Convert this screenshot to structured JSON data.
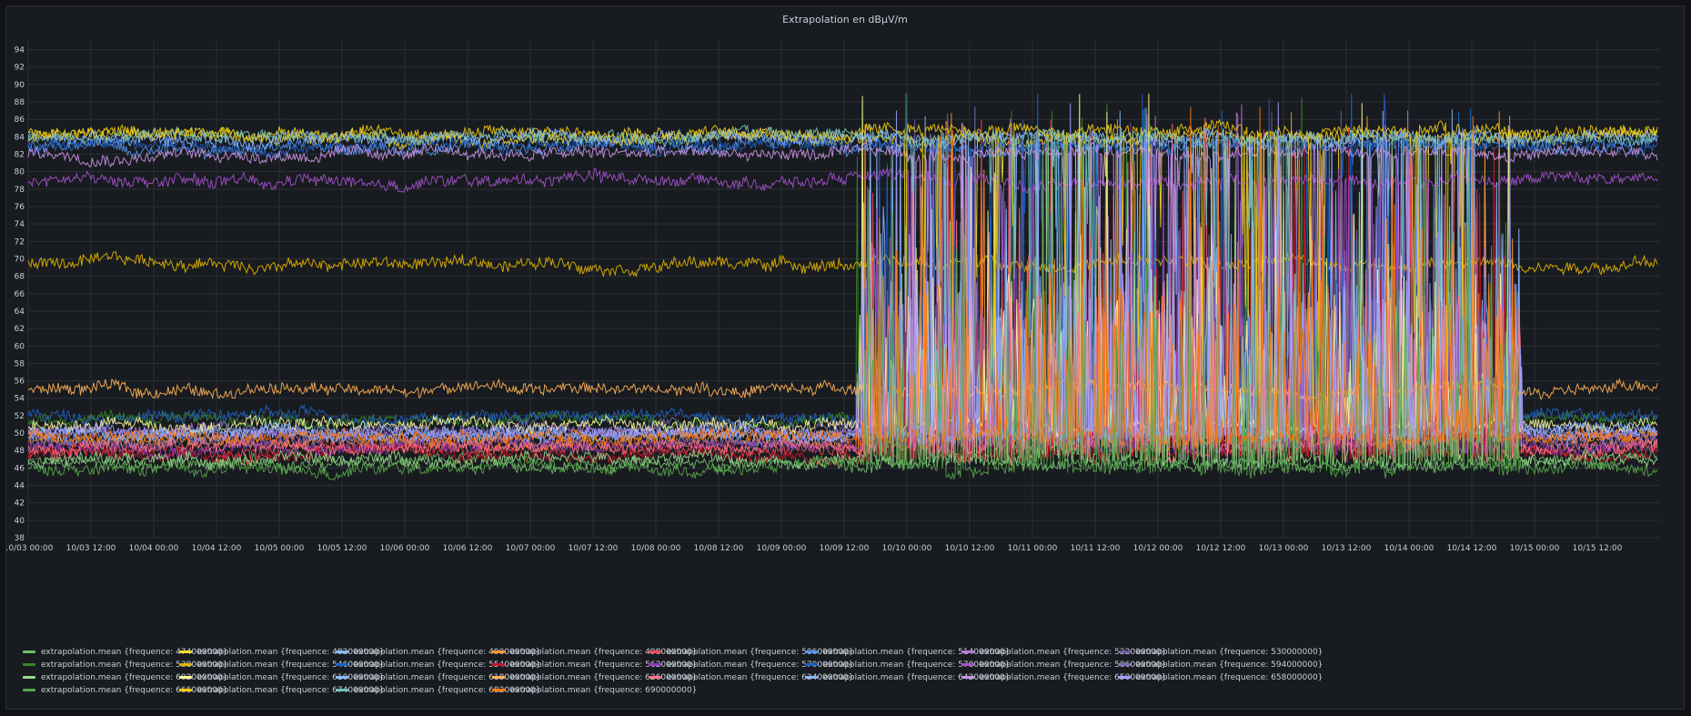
{
  "panel": {
    "title": "Extrapolation en dBµV/m"
  },
  "chart_data": {
    "type": "line",
    "title": "Extrapolation en dBµV/m",
    "xlabel": "",
    "ylabel": "",
    "ylim": [
      38,
      95
    ],
    "xlim": [
      "2023-10-03 00:00",
      "2023-10-15 23:00"
    ],
    "yticks": [
      38,
      40,
      42,
      44,
      46,
      48,
      50,
      52,
      54,
      56,
      58,
      60,
      62,
      64,
      66,
      68,
      70,
      72,
      74,
      76,
      78,
      80,
      82,
      84,
      86,
      88,
      90,
      92,
      94
    ],
    "xticks": [
      "10/03 00:00",
      "10/03 12:00",
      "10/04 00:00",
      "10/04 12:00",
      "10/05 00:00",
      "10/05 12:00",
      "10/06 00:00",
      "10/06 12:00",
      "10/07 00:00",
      "10/07 12:00",
      "10/08 00:00",
      "10/08 12:00",
      "10/09 00:00",
      "10/09 12:00",
      "10/10 00:00",
      "10/10 12:00",
      "10/11 00:00",
      "10/11 12:00",
      "10/12 00:00",
      "10/12 12:00",
      "10/13 00:00",
      "10/13 12:00",
      "10/14 00:00",
      "10/14 12:00",
      "10/15 00:00",
      "10/15 12:00"
    ],
    "grid": true,
    "legend_position": "bottom",
    "x_timestamps_hours": "hourly samples from 10/03 00:00",
    "series": [
      {
        "name": "extrapolation.mean {frequence: 474000000}",
        "color": "#73bf69",
        "baseline": 46.5,
        "active": []
      },
      {
        "name": "extrapolation.mean {frequence: 482000000}",
        "color": "#fade2a",
        "baseline": 84,
        "active": []
      },
      {
        "name": "extrapolation.mean {frequence: 490000000}",
        "color": "#8ab8ff",
        "baseline": 50,
        "active": [
          [
            6.6,
            11.9
          ]
        ]
      },
      {
        "name": "extrapolation.mean {frequence: 498000000}",
        "color": "#ff9830",
        "baseline": 49,
        "active": [
          [
            6.6,
            11.9
          ]
        ]
      },
      {
        "name": "extrapolation.mean {frequence: 506000000}",
        "color": "#f2495c",
        "baseline": 48,
        "active": [
          [
            6.6,
            11.9
          ]
        ]
      },
      {
        "name": "extrapolation.mean {frequence: 514000000}",
        "color": "#5794f2",
        "baseline": 83,
        "active": []
      },
      {
        "name": "extrapolation.mean {frequence: 522000000}",
        "color": "#b877d9",
        "baseline": 50,
        "active": [
          [
            6.6,
            11.9
          ]
        ]
      },
      {
        "name": "extrapolation.mean {frequence: 530000000}",
        "color": "#705da0",
        "baseline": 49,
        "active": [
          [
            6.6,
            11.9
          ]
        ]
      },
      {
        "name": "extrapolation.mean {frequence: 538000000}",
        "color": "#37872d",
        "baseline": 51.5,
        "active": [
          [
            6.6,
            11.9
          ]
        ]
      },
      {
        "name": "extrapolation.mean {frequence: 546000000}",
        "color": "#e0b400",
        "baseline": 69.5,
        "active": []
      },
      {
        "name": "extrapolation.mean {frequence: 554000000}",
        "color": "#1f60c4",
        "baseline": 52,
        "active": [
          [
            6.6,
            11.9
          ]
        ]
      },
      {
        "name": "extrapolation.mean {frequence: 562000000}",
        "color": "#c4162a",
        "baseline": 47.5,
        "active": [
          [
            6.6,
            11.9
          ]
        ]
      },
      {
        "name": "extrapolation.mean {frequence: 570000000}",
        "color": "#8f3bb8",
        "baseline": 48.5,
        "active": [
          [
            6.6,
            11.9
          ]
        ]
      },
      {
        "name": "extrapolation.mean {frequence: 578000000}",
        "color": "#1f60c4",
        "baseline": 83,
        "active": []
      },
      {
        "name": "extrapolation.mean {frequence: 586000000}",
        "color": "#a352cc",
        "baseline": 79,
        "active": []
      },
      {
        "name": "extrapolation.mean {frequence: 594000000}",
        "color": "#806eb7",
        "baseline": 50.5,
        "active": [
          [
            6.6,
            11.9
          ]
        ]
      },
      {
        "name": "extrapolation.mean {frequence: 602000000}",
        "color": "#96d98d",
        "baseline": 47,
        "active": [
          [
            6.6,
            11.9
          ]
        ]
      },
      {
        "name": "extrapolation.mean {frequence: 610000000}",
        "color": "#fff899",
        "baseline": 51,
        "active": [
          [
            6.6,
            11.9
          ]
        ]
      },
      {
        "name": "extrapolation.mean {frequence: 618000000}",
        "color": "#8ab8ff",
        "baseline": 50,
        "active": [
          [
            6.6,
            11.9
          ]
        ]
      },
      {
        "name": "extrapolation.mean {frequence: 626000000}",
        "color": "#ffb357",
        "baseline": 55,
        "active": []
      },
      {
        "name": "extrapolation.mean {frequence: 634000000}",
        "color": "#ff7383",
        "baseline": 48.5,
        "active": [
          [
            6.6,
            11.9
          ]
        ]
      },
      {
        "name": "extrapolation.mean {frequence: 642000000}",
        "color": "#8ab8ff",
        "baseline": 84,
        "active": []
      },
      {
        "name": "extrapolation.mean {frequence: 650000000}",
        "color": "#ca95e5",
        "baseline": 82,
        "active": []
      },
      {
        "name": "extrapolation.mean {frequence: 658000000}",
        "color": "#a0a0ff",
        "baseline": 50,
        "active": [
          [
            6.6,
            11.9
          ]
        ]
      },
      {
        "name": "extrapolation.mean {frequence: 666000000}",
        "color": "#56a64b",
        "baseline": 46,
        "active": [
          [
            6.6,
            11.9
          ]
        ]
      },
      {
        "name": "extrapolation.mean {frequence: 674000000}",
        "color": "#f2cc0c",
        "baseline": 84.5,
        "active": []
      },
      {
        "name": "extrapolation.mean {frequence: 682000000}",
        "color": "#73bfb8",
        "baseline": 84,
        "active": []
      },
      {
        "name": "extrapolation.mean {frequence: 690000000}",
        "color": "#ff780a",
        "baseline": 49.5,
        "active": [
          [
            6.6,
            11.9
          ]
        ]
      }
    ]
  }
}
